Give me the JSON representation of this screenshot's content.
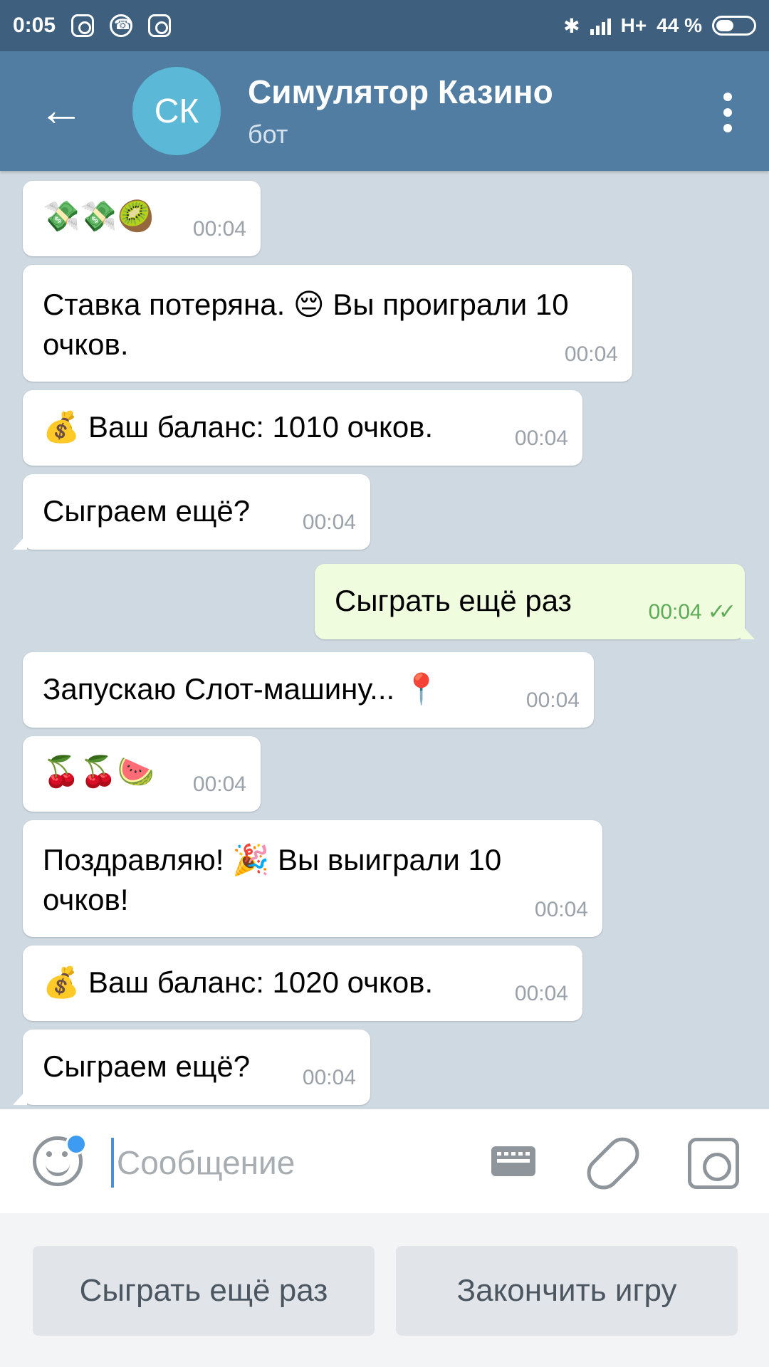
{
  "status_bar": {
    "time": "0:05",
    "network": "H+",
    "battery": "44 %"
  },
  "header": {
    "avatar_initials": "СК",
    "title": "Симулятор Казино",
    "subtitle": "бот"
  },
  "messages": [
    {
      "text": "💸💸🥝",
      "time": "00:04",
      "direction": "in"
    },
    {
      "text": "Ставка потеряна. 😔 Вы проиграли 10 очков.",
      "time": "00:04",
      "direction": "in"
    },
    {
      "text": "💰 Ваш баланс: 1010 очков.",
      "time": "00:04",
      "direction": "in"
    },
    {
      "text": "Сыграем ещё?",
      "time": "00:04",
      "direction": "in"
    },
    {
      "text": "Сыграть ещё раз",
      "time": "00:04",
      "direction": "out"
    },
    {
      "text": "Запускаю Слот-машину... 📍",
      "time": "00:04",
      "direction": "in"
    },
    {
      "text": "🍒🍒🍉",
      "time": "00:04",
      "direction": "in"
    },
    {
      "text": "Поздравляю! 🎉 Вы выиграли 10 очков!",
      "time": "00:04",
      "direction": "in"
    },
    {
      "text": "💰 Ваш баланс: 1020 очков.",
      "time": "00:04",
      "direction": "in"
    },
    {
      "text": "Сыграем ещё?",
      "time": "00:04",
      "direction": "in"
    }
  ],
  "input": {
    "placeholder": "Сообщение"
  },
  "keyboard_buttons": [
    "Сыграть ещё раз",
    "Закончить игру"
  ],
  "colors": {
    "header": "#527da3",
    "status_bar": "#3f5f7e",
    "outgoing_bubble": "#effdde",
    "accent": "#3d9cf1"
  }
}
